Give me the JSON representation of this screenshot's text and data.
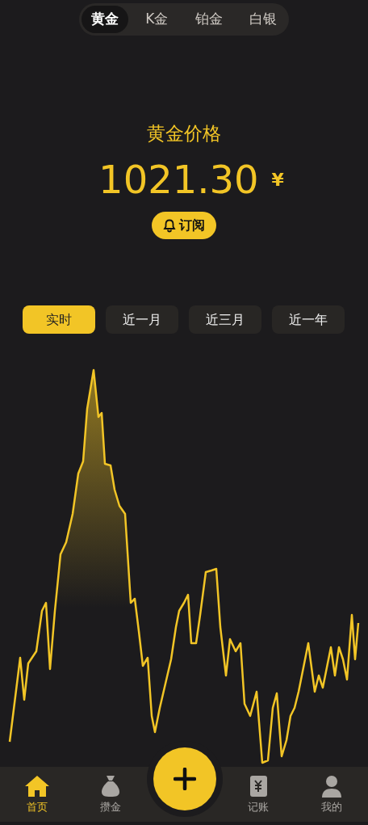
{
  "metal_tabs": [
    {
      "label": "黄金",
      "selected": true
    },
    {
      "label": "K金",
      "selected": false
    },
    {
      "label": "铂金",
      "selected": false
    },
    {
      "label": "白银",
      "selected": false
    }
  ],
  "price": {
    "title": "黄金价格",
    "value": "1021.30",
    "currency": "¥",
    "subscribe": "订阅"
  },
  "ranges": [
    {
      "label": "实时",
      "selected": true
    },
    {
      "label": "近一月",
      "selected": false
    },
    {
      "label": "近三月",
      "selected": false
    },
    {
      "label": "近一年",
      "selected": false
    }
  ],
  "bottom_nav": [
    {
      "label": "首页",
      "kind": "home",
      "selected": true
    },
    {
      "label": "攒金",
      "kind": "bag",
      "selected": false
    },
    {
      "kind": "add"
    },
    {
      "label": "记账",
      "kind": "ledger",
      "selected": false
    },
    {
      "label": "我的",
      "kind": "user",
      "selected": false
    }
  ]
}
